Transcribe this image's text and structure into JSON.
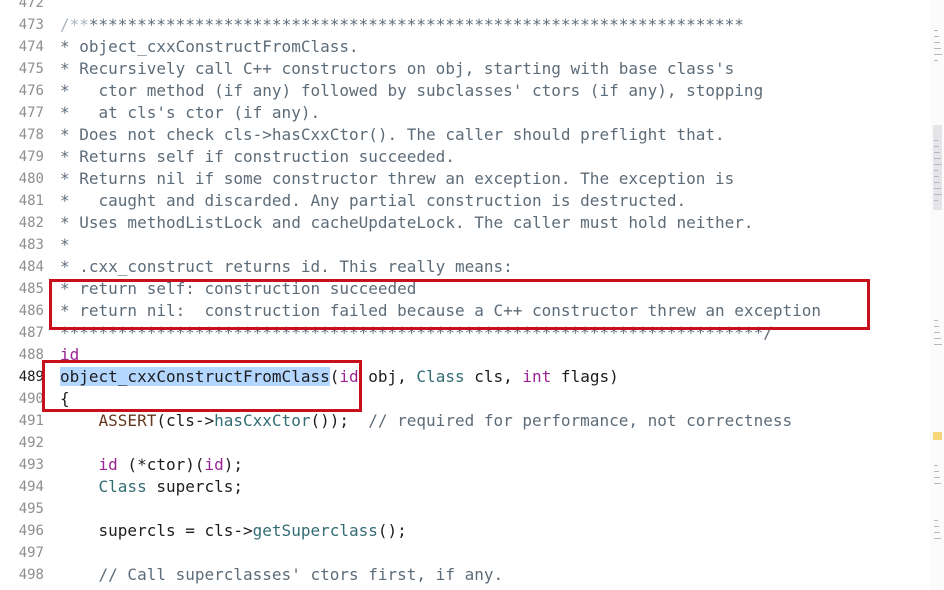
{
  "editor": {
    "lines": [
      {
        "num": "472",
        "tokens": []
      },
      {
        "num": "473",
        "tokens": [
          {
            "t": "/**",
            "c": "comment-faint"
          },
          {
            "t": "********************************************************************",
            "c": "comment"
          }
        ]
      },
      {
        "num": "474",
        "tokens": [
          {
            "t": "* object_cxxConstructFromClass.",
            "c": "comment"
          }
        ]
      },
      {
        "num": "475",
        "tokens": [
          {
            "t": "* Recursively call C++ constructors on obj, starting with base class's",
            "c": "comment"
          }
        ]
      },
      {
        "num": "476",
        "tokens": [
          {
            "t": "*   ctor method (if any) followed by subclasses' ctors (if any), stopping",
            "c": "comment"
          }
        ]
      },
      {
        "num": "477",
        "tokens": [
          {
            "t": "*   at cls's ctor (if any).",
            "c": "comment"
          }
        ]
      },
      {
        "num": "478",
        "tokens": [
          {
            "t": "* Does not check cls->hasCxxCtor(). The caller should preflight that.",
            "c": "comment"
          }
        ]
      },
      {
        "num": "479",
        "tokens": [
          {
            "t": "* Returns self if construction succeeded.",
            "c": "comment"
          }
        ]
      },
      {
        "num": "480",
        "tokens": [
          {
            "t": "* Returns nil if some constructor threw an exception. The exception is",
            "c": "comment"
          }
        ]
      },
      {
        "num": "481",
        "tokens": [
          {
            "t": "*   caught and discarded. Any partial construction is destructed.",
            "c": "comment"
          }
        ]
      },
      {
        "num": "482",
        "tokens": [
          {
            "t": "* Uses methodListLock and cacheUpdateLock. The caller must hold neither.",
            "c": "comment"
          }
        ]
      },
      {
        "num": "483",
        "tokens": [
          {
            "t": "*",
            "c": "comment"
          }
        ]
      },
      {
        "num": "484",
        "tokens": [
          {
            "t": "* .cxx_construct returns id. This really means:",
            "c": "comment"
          }
        ]
      },
      {
        "num": "485",
        "tokens": [
          {
            "t": "* return self: construction succeeded",
            "c": "comment"
          }
        ]
      },
      {
        "num": "486",
        "tokens": [
          {
            "t": "* return nil:  construction failed because a C++ constructor threw an exception",
            "c": "comment"
          }
        ]
      },
      {
        "num": "487",
        "tokens": [
          {
            "t": "*************************************************************************/",
            "c": "comment"
          }
        ]
      },
      {
        "num": "488",
        "tokens": [
          {
            "t": "id",
            "c": "keyword"
          }
        ]
      },
      {
        "num": "489",
        "current": true,
        "tokens": [
          {
            "t": "object_cxxConstructFromClass",
            "c": "sel"
          },
          {
            "t": "(",
            "c": "plain"
          },
          {
            "t": "id",
            "c": "keyword"
          },
          {
            "t": " obj, ",
            "c": "plain"
          },
          {
            "t": "Class",
            "c": "func"
          },
          {
            "t": " cls, ",
            "c": "plain"
          },
          {
            "t": "int",
            "c": "keyword"
          },
          {
            "t": " flags)",
            "c": "plain"
          }
        ]
      },
      {
        "num": "490",
        "tokens": [
          {
            "t": "{",
            "c": "plain"
          }
        ]
      },
      {
        "num": "491",
        "tokens": [
          {
            "t": "    ",
            "c": "plain"
          },
          {
            "t": "ASSERT",
            "c": "macro"
          },
          {
            "t": "(cls->",
            "c": "plain"
          },
          {
            "t": "hasCxxCtor",
            "c": "func"
          },
          {
            "t": "());  ",
            "c": "plain"
          },
          {
            "t": "// required for performance, not correctness",
            "c": "comment"
          }
        ]
      },
      {
        "num": "492",
        "tokens": []
      },
      {
        "num": "493",
        "tokens": [
          {
            "t": "    ",
            "c": "plain"
          },
          {
            "t": "id",
            "c": "keyword"
          },
          {
            "t": " (*ctor)(",
            "c": "plain"
          },
          {
            "t": "id",
            "c": "keyword"
          },
          {
            "t": ");",
            "c": "plain"
          }
        ]
      },
      {
        "num": "494",
        "tokens": [
          {
            "t": "    ",
            "c": "plain"
          },
          {
            "t": "Class",
            "c": "func"
          },
          {
            "t": " supercls;",
            "c": "plain"
          }
        ]
      },
      {
        "num": "495",
        "tokens": []
      },
      {
        "num": "496",
        "tokens": [
          {
            "t": "    supercls = cls->",
            "c": "plain"
          },
          {
            "t": "getSuperclass",
            "c": "func"
          },
          {
            "t": "();",
            "c": "plain"
          }
        ]
      },
      {
        "num": "497",
        "tokens": []
      },
      {
        "num": "498",
        "tokens": [
          {
            "t": "    ",
            "c": "plain"
          },
          {
            "t": "// Call superclasses' ctors first, if any.",
            "c": "comment"
          }
        ]
      }
    ]
  },
  "colors": {
    "annotation": "#c8101c",
    "selection": "#b3d7ff",
    "keyword": "#9b2393",
    "comment": "#5d6c79",
    "function": "#326d74"
  }
}
